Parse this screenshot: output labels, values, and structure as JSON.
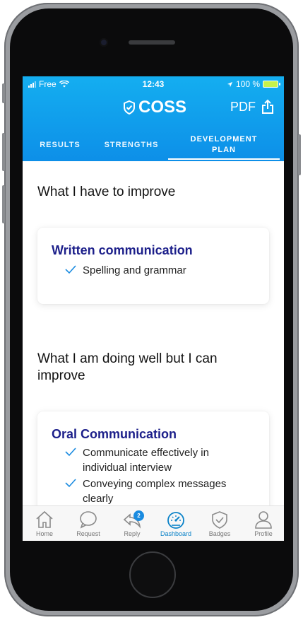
{
  "status_bar": {
    "carrier": "Free",
    "time": "12:43",
    "battery": "100 %"
  },
  "header": {
    "logo_text": "COSS",
    "pdf_label": "PDF"
  },
  "tabs": [
    {
      "label": "RESULTS",
      "active": false
    },
    {
      "label": "STRENGTHS",
      "active": false
    },
    {
      "label": "DEVELOPMENT PLAN",
      "active": true
    }
  ],
  "sections": [
    {
      "title": "What I have to improve",
      "card_title": "Written communication",
      "items": [
        "Spelling and grammar"
      ]
    },
    {
      "title": "What I am doing well but I can improve",
      "card_title": "Oral Communication",
      "items": [
        "Communicate effectively in individual interview",
        "Conveying complex messages clearly"
      ]
    }
  ],
  "bottom_nav": [
    {
      "label": "Home",
      "icon": "home-icon",
      "active": false
    },
    {
      "label": "Request",
      "icon": "chat-bubble-icon",
      "active": false
    },
    {
      "label": "Reply",
      "icon": "reply-icon",
      "active": false,
      "badge": "2"
    },
    {
      "label": "Dashboard",
      "icon": "speedometer-icon",
      "active": true
    },
    {
      "label": "Badges",
      "icon": "shield-check-icon",
      "active": false
    },
    {
      "label": "Profile",
      "icon": "person-icon",
      "active": false
    }
  ],
  "colors": {
    "header_gradient_top": "#14aef0",
    "header_gradient_bottom": "#0d8fe8",
    "card_title": "#1c1f8a",
    "check": "#1a8be0",
    "nav_active": "#0a82c8"
  }
}
